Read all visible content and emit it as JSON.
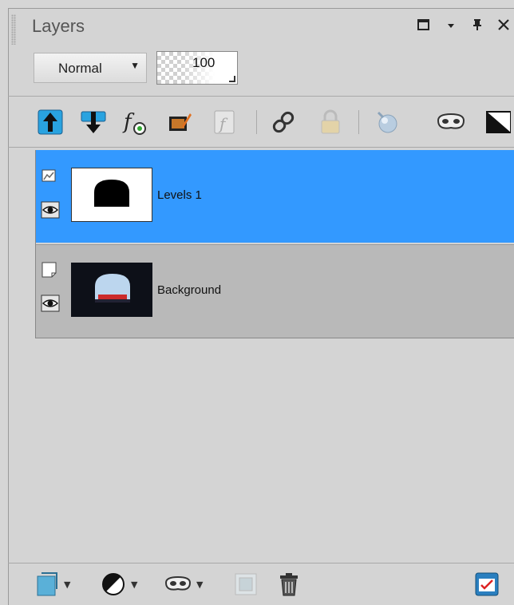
{
  "panel": {
    "title": "Layers"
  },
  "window_controls": {
    "maximize": "☐",
    "menu": "▾",
    "pin": "⊥",
    "close": "✕"
  },
  "properties": {
    "blend_mode": "Normal",
    "opacity": "100"
  },
  "toolbar": {
    "icons": [
      "move-layer-up-icon",
      "move-layer-down-icon",
      "layer-styles-icon",
      "edit-selection-icon",
      "vector-icon",
      "link-layers-icon",
      "lock-icon",
      "toggle-mask-icon",
      "mask-icon",
      "adjustment-icon"
    ]
  },
  "layers": [
    {
      "name": "Levels 1",
      "selected": true,
      "type": "adjustment"
    },
    {
      "name": "Background",
      "selected": false,
      "type": "raster"
    }
  ],
  "bottom_toolbar": {
    "icons": [
      "new-raster-layer-icon",
      "new-adjustment-layer-icon",
      "new-mask-layer-icon",
      "new-group-icon",
      "delete-layer-icon",
      "layer-properties-icon"
    ]
  },
  "colors": {
    "selection": "#3399ff",
    "panel": "#d4d4d4",
    "row_background": "#b9b9b9"
  }
}
